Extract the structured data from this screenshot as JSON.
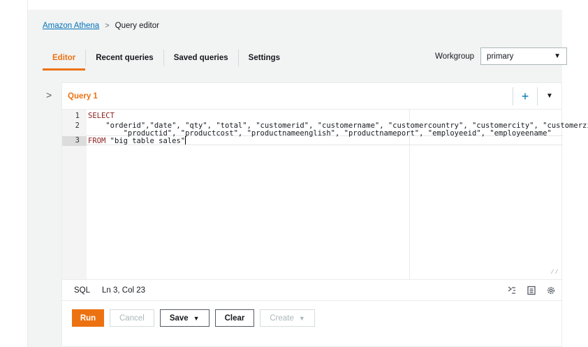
{
  "breadcrumb": {
    "service": "Amazon Athena",
    "current": "Query editor"
  },
  "tabs": [
    {
      "label": "Editor",
      "active": true
    },
    {
      "label": "Recent queries",
      "active": false
    },
    {
      "label": "Saved queries",
      "active": false
    },
    {
      "label": "Settings",
      "active": false
    }
  ],
  "workgroup": {
    "label": "Workgroup",
    "value": "primary"
  },
  "query_tab": {
    "label": "Query 1"
  },
  "editor": {
    "line_numbers": [
      "1",
      "2",
      "3"
    ],
    "lines": [
      {
        "keyword": "SELECT",
        "text": ""
      },
      {
        "keyword": "",
        "text": "    \"orderid\",\"date\", \"qty\", \"total\", \"customerid\", \"customername\", \"customercountry\", \"customercity\", \"customerzip\","
      },
      {
        "keyword": "",
        "text": "        \"productid\", \"productcost\", \"productnameenglish\", \"productnameport\", \"employeeid\", \"employeename\""
      },
      {
        "keyword": "FROM",
        "text": " \"big table sales\""
      }
    ]
  },
  "status": {
    "language": "SQL",
    "cursor": "Ln 3, Col 23"
  },
  "actions": {
    "run": "Run",
    "cancel": "Cancel",
    "save": "Save",
    "clear": "Clear",
    "create": "Create"
  },
  "colors": {
    "accent": "#ec7211",
    "link": "#0073bb"
  },
  "icons": [
    "chevron-right-icon",
    "plus-icon",
    "caret-down-icon",
    "format-icon",
    "shortcuts-icon",
    "settings-gear-icon"
  ]
}
